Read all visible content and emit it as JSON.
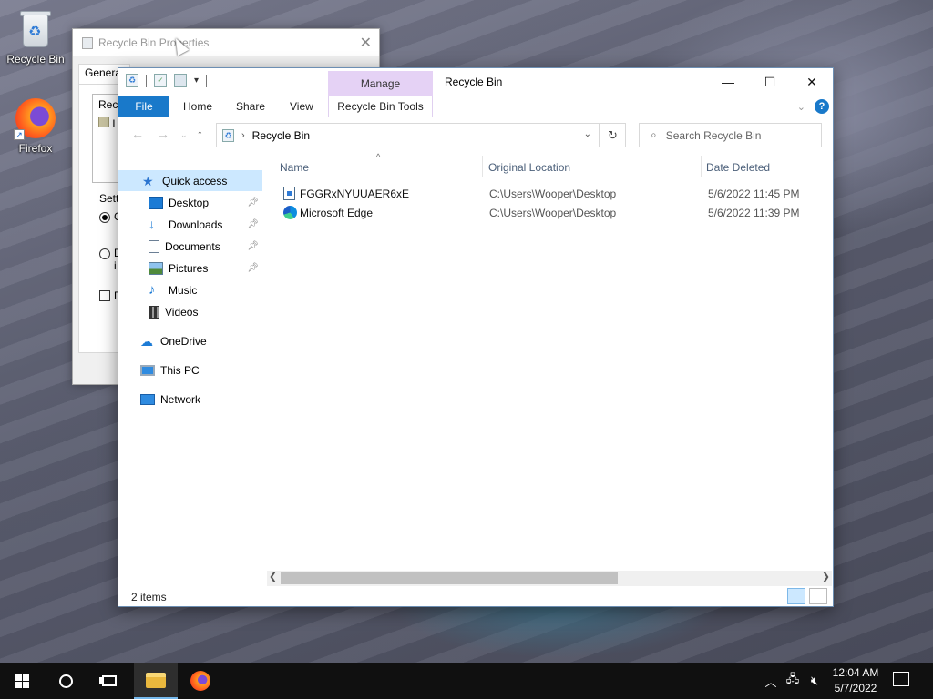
{
  "desktop": {
    "icons": [
      {
        "label": "Recycle Bin",
        "icon": "recycle-bin-icon"
      },
      {
        "label": "Firefox",
        "icon": "firefox-icon"
      }
    ]
  },
  "properties_dialog": {
    "title": "Recycle Bin Properties",
    "tab_general": "General",
    "list_header_partial": "Recy",
    "list_item_partial": "L",
    "settings_partial": "Sett",
    "radio1_partial": "C",
    "radio2_partial": "D",
    "radio2_line2_partial": "i",
    "checkbox_partial": "D"
  },
  "explorer": {
    "window_title": "Recycle Bin",
    "contextual_group": "Manage",
    "ribbon_tabs": {
      "file": "File",
      "home": "Home",
      "share": "Share",
      "view": "View",
      "tools": "Recycle Bin Tools"
    },
    "address": {
      "path": "Recycle Bin"
    },
    "search": {
      "placeholder": "Search Recycle Bin"
    },
    "nav": {
      "quick_access": "Quick access",
      "desktop": "Desktop",
      "downloads": "Downloads",
      "documents": "Documents",
      "pictures": "Pictures",
      "music": "Music",
      "videos": "Videos",
      "onedrive": "OneDrive",
      "this_pc": "This PC",
      "network": "Network"
    },
    "columns": {
      "name": "Name",
      "original_location": "Original Location",
      "date_deleted": "Date Deleted"
    },
    "items": [
      {
        "name": "FGGRxNYUUAER6xE",
        "location": "C:\\Users\\Wooper\\Desktop",
        "date": "5/6/2022 11:45 PM"
      },
      {
        "name": "Microsoft Edge",
        "location": "C:\\Users\\Wooper\\Desktop",
        "date": "5/6/2022 11:39 PM"
      }
    ],
    "status": "2 items"
  },
  "taskbar": {
    "time": "12:04 AM",
    "date": "5/7/2022"
  }
}
